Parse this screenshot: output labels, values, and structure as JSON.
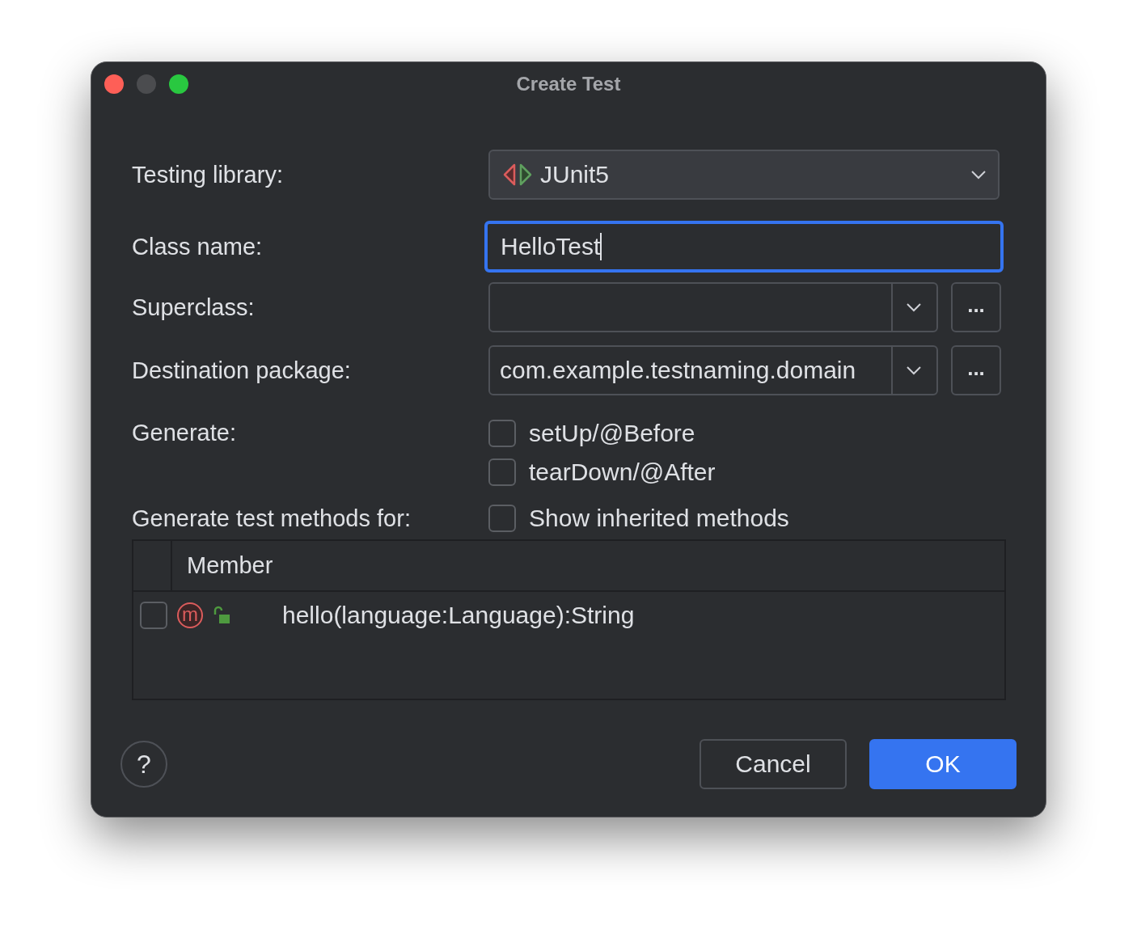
{
  "window": {
    "title": "Create Test"
  },
  "testing_library": {
    "label": "Testing library:",
    "value": "JUnit5"
  },
  "class_name": {
    "label": "Class name:",
    "value": "HelloTest",
    "focused": true
  },
  "superclass": {
    "label": "Superclass:",
    "browse": "..."
  },
  "destination_package": {
    "label": "Destination package:",
    "value": "com.example.testnaming.domain",
    "browse": "..."
  },
  "generate": {
    "label": "Generate:",
    "options": [
      {
        "label": "setUp/@Before",
        "checked": false
      },
      {
        "label": "tearDown/@After",
        "checked": false
      }
    ]
  },
  "test_methods": {
    "label": "Generate test methods for:",
    "show_inherited": {
      "label": "Show inherited methods",
      "checked": false
    },
    "table": {
      "columns": [
        "Member"
      ],
      "rows": [
        {
          "icon_letter": "m",
          "member": "hello(language:Language):String",
          "checked": false
        }
      ]
    }
  },
  "buttons": [
    {
      "label": "Cancel",
      "kind": "secondary"
    },
    {
      "label": "OK",
      "kind": "primary"
    }
  ],
  "help": "?"
}
